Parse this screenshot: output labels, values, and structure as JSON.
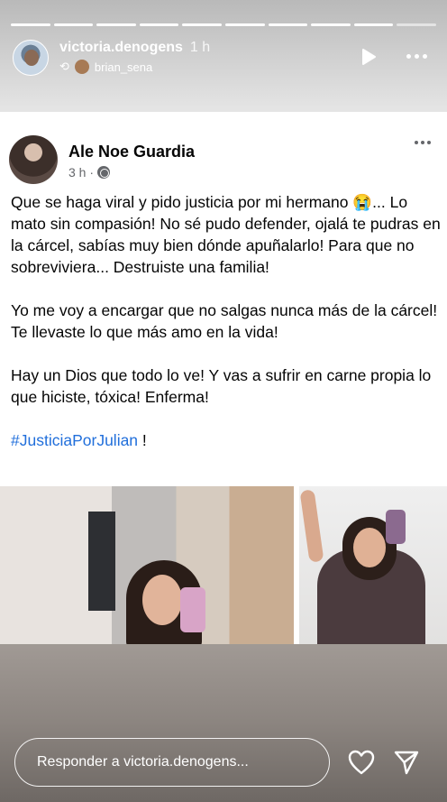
{
  "progress": {
    "total_segments": 10,
    "completed_segments": 9
  },
  "header": {
    "username": "victoria.denogens",
    "time": "1 h",
    "reposted_from": "brian_sena"
  },
  "post": {
    "author": "Ale Noe Guardia",
    "time": "3 h · ",
    "paragraphs": [
      "Que se haga viral y pido justicia por mi hermano 😭... Lo mato sin compasión! No sé pudo defender, ojalá te pudras en la cárcel, sabías muy bien dónde apuñalarlo! Para que no sobreviviera... Destruiste una familia!",
      "Yo me voy a encargar que no salgas nunca más de la cárcel! Te llevaste lo que más amo en la vida!",
      "Hay un Dios que todo lo ve! Y vas a sufrir en carne propia lo que hiciste, tóxica! Enferma!"
    ],
    "hashtag": "#JusticiaPorJulian",
    "hashtag_suffix": " !"
  },
  "reply": {
    "placeholder": "Responder a victoria.denogens..."
  },
  "icons": {
    "play": "play-icon",
    "more": "more-icon",
    "repost": "repost-icon",
    "globe": "globe-icon",
    "heart": "heart-icon",
    "send": "send-icon"
  }
}
